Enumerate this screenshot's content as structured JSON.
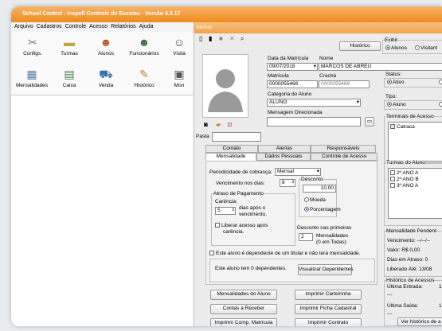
{
  "app": {
    "title": "School Control - Inspell Controle de Escolas - Versão 4.3.17"
  },
  "menu": [
    "Arquivo",
    "Cadastros",
    "Controle",
    "Acesso",
    "Relatórios",
    "Ajuda"
  ],
  "toolbar": {
    "row1": [
      {
        "label": "Configs.",
        "icon": "tools-icon",
        "glyph": "✂"
      },
      {
        "label": "Turmas",
        "icon": "folder-icon",
        "glyph": "▬"
      },
      {
        "label": "Alunos",
        "icon": "students-icon",
        "glyph": "☻"
      },
      {
        "label": "Funcionários",
        "icon": "staff-icon",
        "glyph": "☻"
      },
      {
        "label": "Visita",
        "icon": "visitor-icon",
        "glyph": "☺"
      }
    ],
    "row2": [
      {
        "label": "Mensalidades",
        "icon": "calendar-icon",
        "glyph": "▦"
      },
      {
        "label": "Caixa",
        "icon": "calculator-icon",
        "glyph": "▤"
      },
      {
        "label": "Venda",
        "icon": "cart-icon",
        "glyph": "⛟"
      },
      {
        "label": "Histórico",
        "icon": "history-icon",
        "glyph": "✎"
      },
      {
        "label": "Mon",
        "icon": "monitor-icon",
        "glyph": "▣"
      }
    ]
  },
  "form": {
    "window_title": "Alunos",
    "historico_button": "Histórico",
    "exibir": {
      "label": "Exibir",
      "opt_alunos": "Alunos",
      "opt_visitantes": "Visitant"
    },
    "data_matricula_label": "Data da Matrícula",
    "data_matricula": "09/07/2018",
    "nome_label": "Nome",
    "nome": "MARCOS DE ABREU",
    "matricula_label": "Matrícula",
    "matricula": "0000055468",
    "cracha_label": "Crachá",
    "cracha": "0000055468",
    "categoria_label": "Categoria do Aluno",
    "categoria": "ALUNO",
    "mensagem_label": "Mensagem Direcionada",
    "pasta_label": "Pasta",
    "status": {
      "label": "Status:",
      "opt_ativo": "Ativo"
    },
    "tipo": {
      "label": "Tipo:",
      "opt_aluno": "Aluno"
    },
    "terminais": {
      "label": "Terminais de Acesso",
      "items": [
        "Catraca"
      ]
    },
    "turmas": {
      "label": "Turmas do Aluno",
      "items": [
        "2º ANO A",
        "2º ANO B",
        "3º ANO A"
      ]
    },
    "mensalidade_pendente": {
      "label": "Mensalidade Pendent",
      "vencimento": "Vencimento: --/--/--",
      "valor": "Valor: R$ 0,00",
      "dias_atraso": "Dias em Atraso: 0",
      "liberado_ate": "Liberado Até: 13/08"
    },
    "historico_acessos": {
      "label": "Histórico de Acessos",
      "ultima_entrada": "Última Entrada:",
      "ultima_entrada_val": "1",
      "ultima_saida": "Última Saída:",
      "ultima_saida_val": "1",
      "dash": "---",
      "ver_button": "Ver histórico de a"
    },
    "tabs_row1": [
      "Contato",
      "Alertas",
      "Responsáveis"
    ],
    "tabs_row2": [
      "Mensalidade",
      "Dados Pessoais",
      "Controle de Acesso"
    ],
    "mensalidade": {
      "periodicidade_label": "Periodicidade de cobrança:",
      "periodicidade": "Mensal",
      "vencimento_label": "Vencimento nos dias:",
      "vencimento": "8",
      "desconto_label": "Desconto",
      "desconto": "10.00",
      "moeda": "Moeda",
      "porcentagem": "Porcentagem",
      "atraso_label": "Atraso de Pagamento",
      "carencia_label": "Carência:",
      "carencia": "5",
      "dias_apos": "dias após o",
      "vencimento_word": "vencimento.",
      "liberar_label": "Liberar acesso após",
      "carencia_word": "carência.",
      "desconto_primeiras": "Desconto nas primeiras",
      "primeiras_valor": "2",
      "mensalidades_word": "Mensalidades",
      "em_todas": "(0 em Todas)",
      "dependente_check": "Este aluno é dependente de um titular e não terá mensalidade.",
      "dependentes_text": "Este aluno tem 0 dependentes.",
      "visualizar_button": "Visualizar Dependentes"
    },
    "buttons": {
      "mensalidades_aluno": "Mensalidades do Aluno",
      "imprimir_carteirinha": "Imprimir Carteirinha",
      "contas_receber": "Contas a Receber",
      "imprimir_ficha": "Imprimir Ficha Cadastral",
      "imprimir_comp": "Imprimir Comp. Matrícula",
      "imprimir_contrato": "Imprimir Contrato"
    }
  },
  "colors": {
    "title_orange": "#f08a1e",
    "accent_blue": "#2a6ee0"
  }
}
